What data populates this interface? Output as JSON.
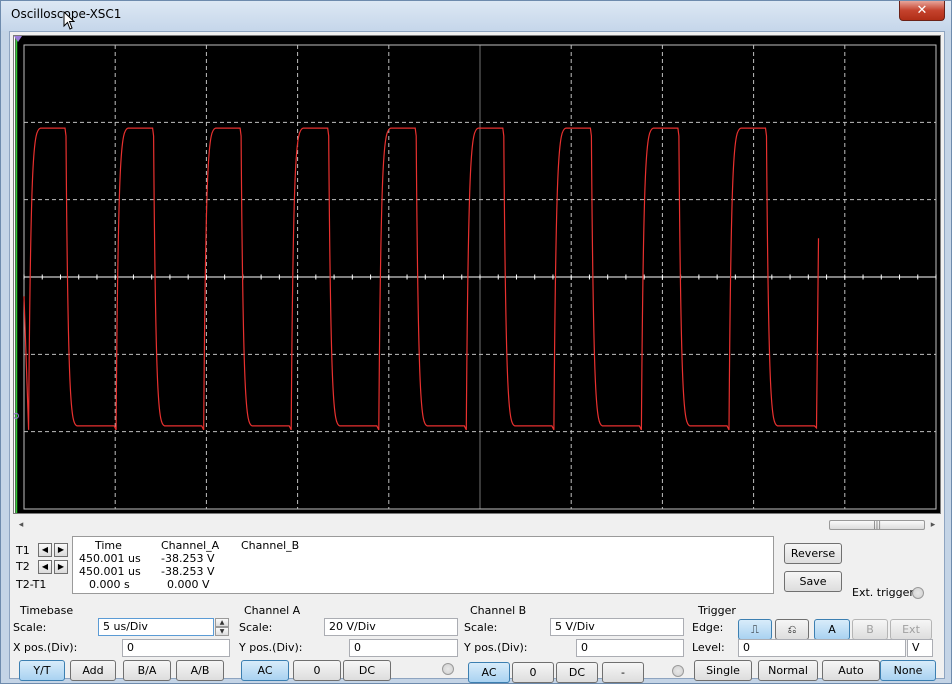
{
  "window": {
    "title": "Oscilloscope-XSC1",
    "close_label": "✕"
  },
  "display": {
    "background": "#000000",
    "trace_color": "#e8312f",
    "grid_color": "#bfbfbf",
    "chart_data": {
      "type": "line",
      "title": "",
      "xlabel": "",
      "ylabel": "",
      "grid": true,
      "x_units": "us",
      "x_divisions": 10,
      "y_divisions": 6,
      "x_scale": "5 us/Div",
      "y_scale": "20 V/Div",
      "xlim": [
        405.4,
        455.4
      ],
      "ylim": [
        -60,
        60
      ],
      "series": [
        {
          "channel": "A",
          "description_levels_V": [
            38.5,
            -38.5
          ],
          "period_us": 4.8,
          "high_us": 2.0,
          "pulses": 9,
          "high_level_V": 38.5,
          "low_level_V": -38.5
        }
      ]
    }
  },
  "scrollbar": {
    "thumb_glyph": "|||",
    "left_arrow": "◂",
    "right_arrow": "▸"
  },
  "cursors": {
    "t1_label": "T1",
    "t2_label": "T2",
    "t21_label": "T2-T1",
    "left_arrow": "◀",
    "right_arrow": "▶"
  },
  "readout": {
    "headers": [
      "Time",
      "Channel_A",
      "Channel_B"
    ],
    "t1": {
      "time": "450.001 us",
      "a": "-38.253 V",
      "b": ""
    },
    "t2": {
      "time": "450.001 us",
      "a": "-38.253 V",
      "b": ""
    },
    "t21": {
      "time": "0.000 s",
      "a": "0.000 V",
      "b": ""
    }
  },
  "side_buttons": {
    "reverse": "Reverse",
    "save": "Save",
    "ext_trigger": "Ext. trigger"
  },
  "timebase": {
    "group": "Timebase",
    "scale_label": "Scale:",
    "scale_value": "5 us/Div",
    "xpos_label": "X pos.(Div):",
    "xpos_value": "0",
    "modes": [
      "Y/T",
      "Add",
      "B/A",
      "A/B"
    ],
    "active_mode": "Y/T"
  },
  "channel_a": {
    "group": "Channel A",
    "scale_label": "Scale:",
    "scale_value": "20  V/Div",
    "ypos_label": "Y pos.(Div):",
    "ypos_value": "0",
    "coupling": [
      "AC",
      "0",
      "DC"
    ],
    "active": "AC"
  },
  "channel_b": {
    "group": "Channel B",
    "scale_label": "Scale:",
    "scale_value": "5  V/Div",
    "ypos_label": "Y pos.(Div):",
    "ypos_value": "0",
    "coupling": [
      "AC",
      "0",
      "DC",
      "-"
    ],
    "active": "AC"
  },
  "trigger": {
    "group": "Trigger",
    "edge_label": "Edge:",
    "edge_rise": "⎍",
    "edge_fall": "⎌",
    "sources": [
      "A",
      "B",
      "Ext"
    ],
    "active_source": "A",
    "level_label": "Level:",
    "level_value": "0",
    "level_unit": "V",
    "modes": [
      "Single",
      "Normal",
      "Auto",
      "None"
    ],
    "active_mode": "None"
  }
}
